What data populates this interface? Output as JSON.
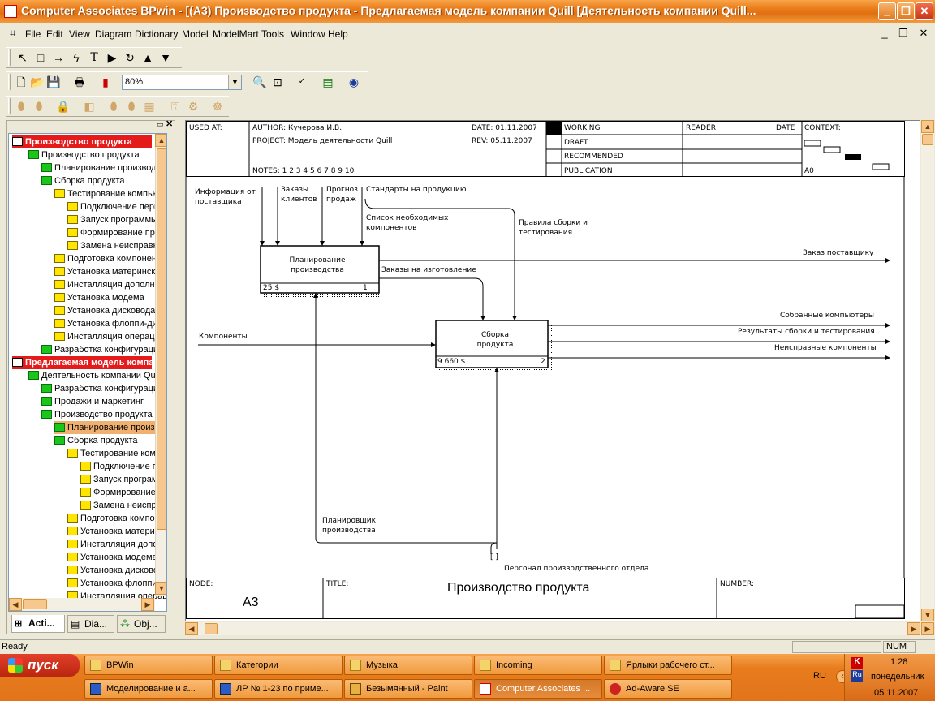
{
  "window": {
    "title": "Computer Associates BPwin - [(A3) Производство продукта - Предлагаемая модель компании Quill  [Деятельность компании Quill...",
    "min_label": "_",
    "max_label": "❐",
    "close_label": "✕"
  },
  "menu": {
    "items": [
      "File",
      "Edit",
      "View",
      "Diagram",
      "Dictionary",
      "Model",
      "ModelMart",
      "Tools",
      "Window",
      "Help"
    ]
  },
  "toolbar": {
    "zoom": "80%"
  },
  "tree": {
    "items": [
      {
        "label": "Производство продукта",
        "kind": "hdr"
      },
      {
        "label": "Производство продукта",
        "kind": "green"
      },
      {
        "label": "Планирование производства",
        "kind": "green"
      },
      {
        "label": "Сборка продукта",
        "kind": "green"
      },
      {
        "label": "Тестирование компьютера",
        "kind": "yellow"
      },
      {
        "label": "Подключение периферии",
        "kind": "yellow"
      },
      {
        "label": "Запуск программы",
        "kind": "yellow"
      },
      {
        "label": "Формирование протокола",
        "kind": "yellow"
      },
      {
        "label": "Замена неисправных",
        "kind": "yellow"
      },
      {
        "label": "Подготовка компонентов",
        "kind": "yellow"
      },
      {
        "label": "Установка материнской",
        "kind": "yellow"
      },
      {
        "label": "Инсталляция дополнительных",
        "kind": "yellow"
      },
      {
        "label": "Установка модема",
        "kind": "yellow"
      },
      {
        "label": "Установка дисковода",
        "kind": "yellow"
      },
      {
        "label": "Установка флоппи-дисковода",
        "kind": "yellow"
      },
      {
        "label": "Инсталляция операционной",
        "kind": "yellow"
      },
      {
        "label": "Разработка конфигурации",
        "kind": "green"
      },
      {
        "label": "Предлагаемая модель компании",
        "kind": "hdr"
      },
      {
        "label": "Деятельность компании Quill",
        "kind": "green"
      },
      {
        "label": "Разработка конфигурации",
        "kind": "green"
      },
      {
        "label": "Продажи и маркетинг",
        "kind": "green"
      },
      {
        "label": "Производство продукта",
        "kind": "green"
      },
      {
        "label": "Планирование производства",
        "kind": "green"
      },
      {
        "label": "Сборка продукта",
        "kind": "green"
      },
      {
        "label": "Тестирование компьютера",
        "kind": "yellow"
      },
      {
        "label": "Подключение периферии",
        "kind": "yellow"
      },
      {
        "label": "Запуск программы",
        "kind": "yellow"
      },
      {
        "label": "Формирование протокола",
        "kind": "yellow"
      },
      {
        "label": "Замена неисправных",
        "kind": "yellow"
      },
      {
        "label": "Подготовка компонентов",
        "kind": "yellow"
      },
      {
        "label": "Установка материнской",
        "kind": "yellow"
      },
      {
        "label": "Инсталляция дополнительных",
        "kind": "yellow"
      },
      {
        "label": "Установка модема",
        "kind": "yellow"
      },
      {
        "label": "Установка дисковода",
        "kind": "yellow"
      },
      {
        "label": "Установка флоппи-дисковода",
        "kind": "yellow"
      },
      {
        "label": "Инсталляция операционной",
        "kind": "yellow"
      }
    ]
  },
  "tabs": [
    "Acti...",
    "Dia...",
    "Obj..."
  ],
  "frame": {
    "used_at": "USED AT:",
    "author": "AUTHOR:  Кучерова И.В.",
    "project": "PROJECT:  Модель деятельности Quill",
    "date": "DATE: 01.11.2007",
    "rev": "REV:   05.11.2007",
    "notes": "NOTES:  1  2  3  4  5  6  7  8  9  10",
    "working": "WORKING",
    "draft": "DRAFT",
    "recommended": "RECOMMENDED",
    "publication": "PUBLICATION",
    "reader": "READER",
    "date2": "DATE",
    "context": "CONTEXT:",
    "context_node": "A0",
    "node_lbl": "NODE:",
    "node": "A3",
    "title_lbl": "TITLE:",
    "title": "Производство продукта",
    "number_lbl": "NUMBER:"
  },
  "diagram": {
    "box1": {
      "name": "Планирование производства",
      "cost": "25 $",
      "num": "1"
    },
    "box2": {
      "name": "Сборка продукта",
      "cost": "9 660 $",
      "num": "2"
    },
    "arrows": {
      "info": "Информация от поставщика",
      "orders": "Заказы клиентов",
      "forecast": "Прогноз продаж",
      "standards": "Стандарты на продукцию",
      "components_list": "Список необходимых компонентов",
      "rules": "Правила сборки и тестирования",
      "supplier_order": "Заказ поставщику",
      "make_orders": "Заказы на изготовление",
      "components": "Компоненты",
      "assembled": "Собранные компьютеры",
      "results": "Результаты сборки и тестирования",
      "faulty": "Неисправные компоненты",
      "planner": "Планировщик производства",
      "staff": "Персонал производственного отдела"
    }
  },
  "status": {
    "ready": "Ready",
    "num": "NUM"
  },
  "taskbar": {
    "start": "пуск",
    "row1": [
      "BPWin",
      "Категории",
      "Музыка",
      "Incoming",
      "Ярлыки рабочего ст..."
    ],
    "row2": [
      "Моделирование и а...",
      "ЛР № 1-23 по приме...",
      "Безымянный - Paint",
      "Computer Associates ...",
      "Ad-Aware SE"
    ],
    "lang": "RU",
    "time": "1:28",
    "day": "понедельник",
    "date": "05.11.2007"
  }
}
